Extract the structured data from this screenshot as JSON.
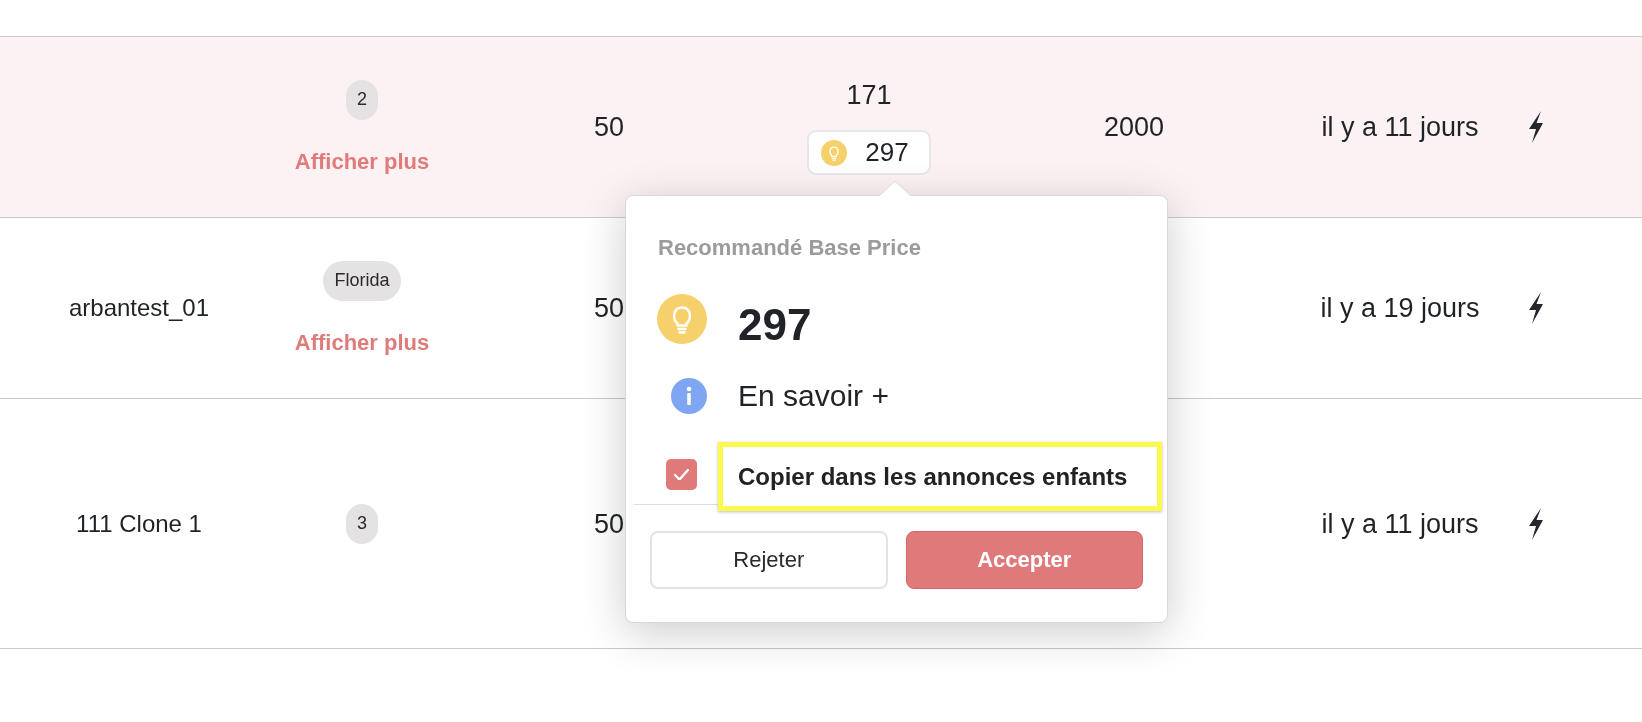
{
  "table": {
    "rows": [
      {
        "selected": true,
        "column_2": {
          "badge": "2",
          "link": "Afficher plus"
        },
        "column_3": "50",
        "column_4": {
          "value": "171",
          "suggestion": "297"
        },
        "column_5": "2000",
        "column_6": "il y a 11 jours"
      },
      {
        "selected": false,
        "column_1": "arbantest_01",
        "column_2": {
          "badge": "Florida",
          "link": "Afficher plus"
        },
        "column_3": "50",
        "column_6": "il y a 19 jours"
      },
      {
        "selected": false,
        "column_1": "111 Clone 1",
        "column_2": {
          "badge": "3"
        },
        "column_3": "50",
        "column_6": "il y a 11 jours"
      }
    ]
  },
  "popover": {
    "title": "Recommandé Base Price",
    "value": "297",
    "learn_more": "En savoir +",
    "checkbox": {
      "label": "Copier dans les annonces enfants",
      "checked": true,
      "highlighted": true
    },
    "buttons": [
      {
        "label": "Rejeter",
        "kind": "secondary"
      },
      {
        "label": "Accepter",
        "kind": "primary"
      }
    ]
  }
}
